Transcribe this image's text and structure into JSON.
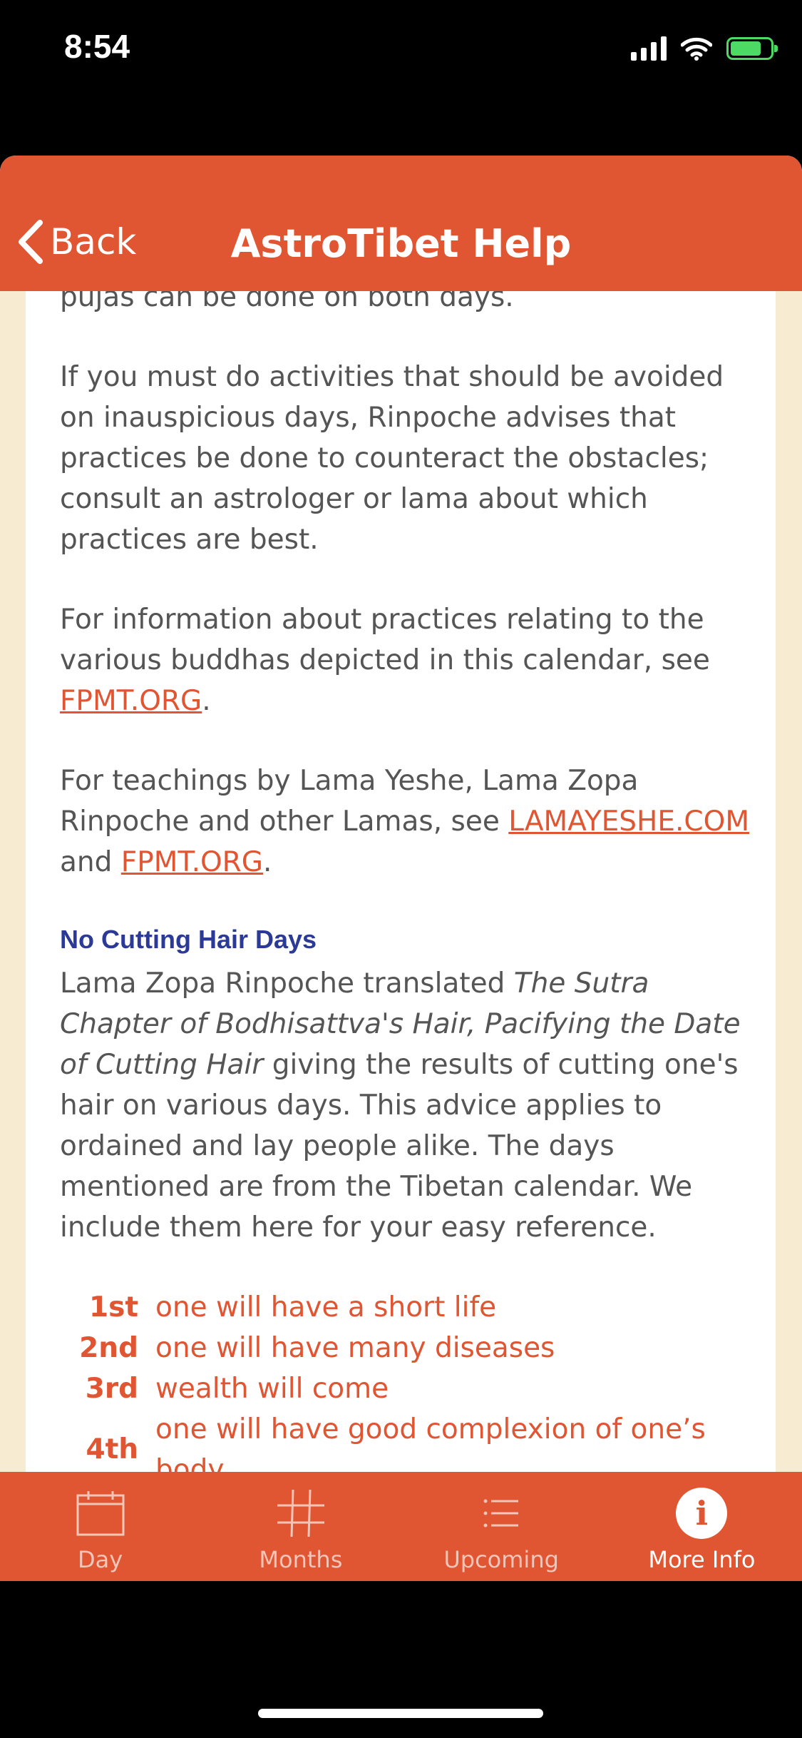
{
  "status": {
    "time": "8:54"
  },
  "nav": {
    "back_label": "Back",
    "title": "AstroTibet Help"
  },
  "content": {
    "p_partial": "pujas can be done on both days.",
    "p_inauspicious": "If you must do activities that should be avoided on inauspicious days, Rinpoche advises that practices be done to counteract the obstacles; consult an astrologer or lama about which practices are best.",
    "p_info_pre": "For information about practices relating to the various buddhas depicted in this calendar, see ",
    "p_info_link": "FPMT.ORG",
    "p_info_post": ".",
    "p_teach_pre": "For teachings by Lama Yeshe, Lama Zopa Rinpoche and other Lamas, see ",
    "p_teach_link1": "LAMAYESHE.COM",
    "p_teach_mid": " and ",
    "p_teach_link2": "FPMT.ORG",
    "p_teach_post": ".",
    "hair_heading": "No Cutting Hair Days",
    "hair_intro_1": "Lama Zopa Rinpoche translated ",
    "hair_intro_title": "The Sutra Chapter of Bodhisattva's Hair, Pacifying the Date of Cutting Hair",
    "hair_intro_2": " giving the results of cutting one's hair on various days. This advice applies to ordained and lay people alike. The days mentioned are from the Tibetan calendar. We include them here for your easy reference.",
    "hair_days": [
      {
        "day": "1st",
        "result": "one will have a short life"
      },
      {
        "day": "2nd",
        "result": "one will have many diseases"
      },
      {
        "day": "3rd",
        "result": "wealth will come"
      },
      {
        "day": "4th",
        "result": "one will have good complexion of one’s body"
      }
    ]
  },
  "tabs": [
    {
      "label": "Day",
      "icon": "calendar-icon"
    },
    {
      "label": "Months",
      "icon": "grid-icon"
    },
    {
      "label": "Upcoming",
      "icon": "list-icon"
    },
    {
      "label": "More Info",
      "icon": "info-icon"
    }
  ],
  "colors": {
    "accent": "#e05532",
    "heading": "#2b3a96",
    "background": "#f7ecd2",
    "text": "#555555"
  }
}
